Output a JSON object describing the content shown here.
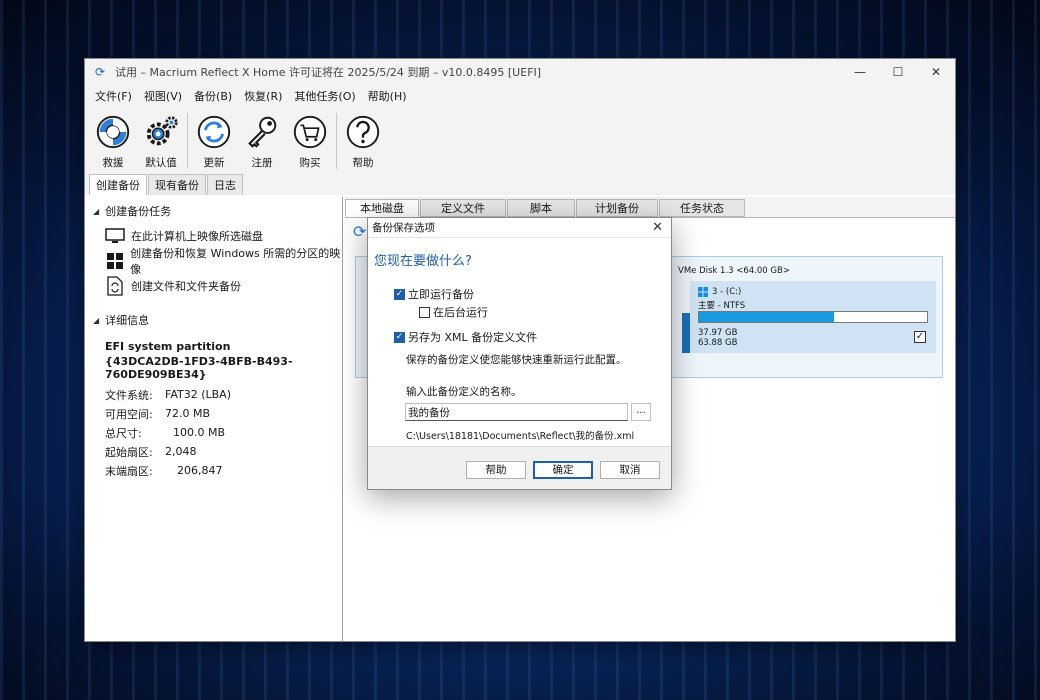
{
  "window": {
    "title": "试用 – Macrium Reflect X Home 许可证将在 2025/5/24 到期 – v10.0.8495  [UEFI]",
    "controls": {
      "minimize": "—",
      "maximize": "☐",
      "close": "✕"
    }
  },
  "menu": [
    "文件(F)",
    "视图(V)",
    "备份(B)",
    "恢复(R)",
    "其他任务(O)",
    "帮助(H)"
  ],
  "toolbar": {
    "rescue": "救援",
    "defaults": "默认值",
    "update": "更新",
    "register": "注册",
    "buy": "购买",
    "help": "帮助"
  },
  "left_tabs": [
    "创建备份",
    "现有备份",
    "日志"
  ],
  "tasks": {
    "heading": "创建备份任务",
    "items": [
      "在此计算机上映像所选磁盘",
      "创建备份和恢复 Windows 所需的分区的映像",
      "创建文件和文件夹备份"
    ]
  },
  "details": {
    "heading": "详细信息",
    "partition_name": "EFI system partition",
    "partition_guid": "{43DCA2DB-1FD3-4BFB-B493-760DE909BE34}",
    "rows": [
      {
        "k": "文件系统:",
        "v": "FAT32 (LBA)"
      },
      {
        "k": "可用空间:",
        "v": "72.0 MB"
      },
      {
        "k": "总尺寸:",
        "v": "100.0 MB"
      },
      {
        "k": "起始扇区:",
        "v": "2,048"
      },
      {
        "k": "末端扇区:",
        "v": "206,847"
      }
    ]
  },
  "right_tabs": [
    "本地磁盘",
    "定义文件",
    "脚本",
    "计划备份",
    "任务状态"
  ],
  "disk": {
    "name": "VMe Disk 1.3  <64.00 GB>",
    "partition_c": {
      "label": "3 -  (C:)",
      "fs": "主要 - NTFS",
      "used": "37.97 GB",
      "total": "63.88 GB",
      "used_fraction": 0.594,
      "checked": true
    }
  },
  "dialog": {
    "title": "备份保存选项",
    "close": "✕",
    "heading": "您现在要做什么?",
    "run_now": {
      "label": "立即运行备份",
      "checked": true
    },
    "run_background": {
      "label": "在后台运行",
      "checked": false
    },
    "save_xml": {
      "label": "另存为 XML 备份定义文件",
      "checked": true
    },
    "save_desc": "保存的备份定义使您能够快速重新运行此配置。",
    "name_label": "输入此备份定义的名称。",
    "name_value": "我的备份",
    "browse": "...",
    "path": "C:\\Users\\18181\\Documents\\Reflect\\我的备份.xml",
    "buttons": {
      "help": "帮助",
      "ok": "确定",
      "cancel": "取消"
    }
  }
}
